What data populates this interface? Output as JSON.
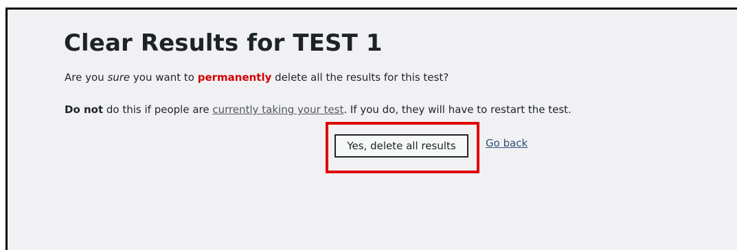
{
  "page": {
    "title": "Clear Results for TEST 1",
    "confirm": {
      "prefix": "Are you ",
      "emphasis": "sure",
      "middle": " you want to ",
      "strong": "permanently",
      "suffix": " delete all the results for this test?"
    },
    "warning": {
      "strong": "Do not",
      "before_link": " do this if people are ",
      "link": "currently taking your test",
      "after_link": ". If you do, they will have to restart the test."
    },
    "actions": {
      "delete_label": "Yes, delete all results",
      "back_label": "Go back"
    }
  },
  "colors": {
    "background": "#f1f1f3",
    "emphasis_red": "#d10000",
    "highlight_box": "#e00000",
    "link": "#2c4d7a"
  }
}
